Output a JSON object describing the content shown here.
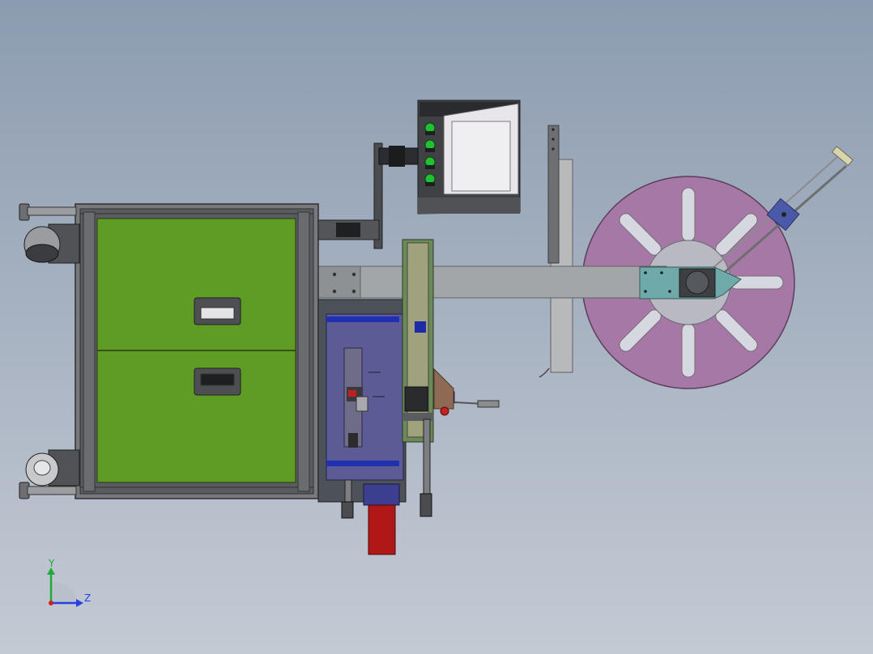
{
  "viewport": {
    "background_top": "#8c9cb0",
    "background_bottom": "#c4cad4"
  },
  "triad": {
    "y_label": "Y",
    "z_label": "Z",
    "y_color": "#1faa3a",
    "z_color": "#2a3fe0",
    "origin_color": "#d02020"
  },
  "colors": {
    "cabinet_panel": "#5f9c25",
    "reel_disc": "#a678a6",
    "reel_hub": "#b9b9c2",
    "arm_beam": "#a3a6a8",
    "mount_plate": "#70a9a9",
    "slide_block": "#4a5aa8",
    "base_plate": "#5b5b96",
    "strip_blue": "#2030b0",
    "motor_red": "#b01818",
    "magenta_block": "#9a2ba0",
    "brown_bracket": "#8e6a54",
    "indicator_green": "#20c030",
    "screen_panel": "#e8e6ea"
  },
  "parts": {
    "caster_wheels": 2,
    "drawers": 2,
    "indicator_lights": 4,
    "reel_spokes": 8
  }
}
